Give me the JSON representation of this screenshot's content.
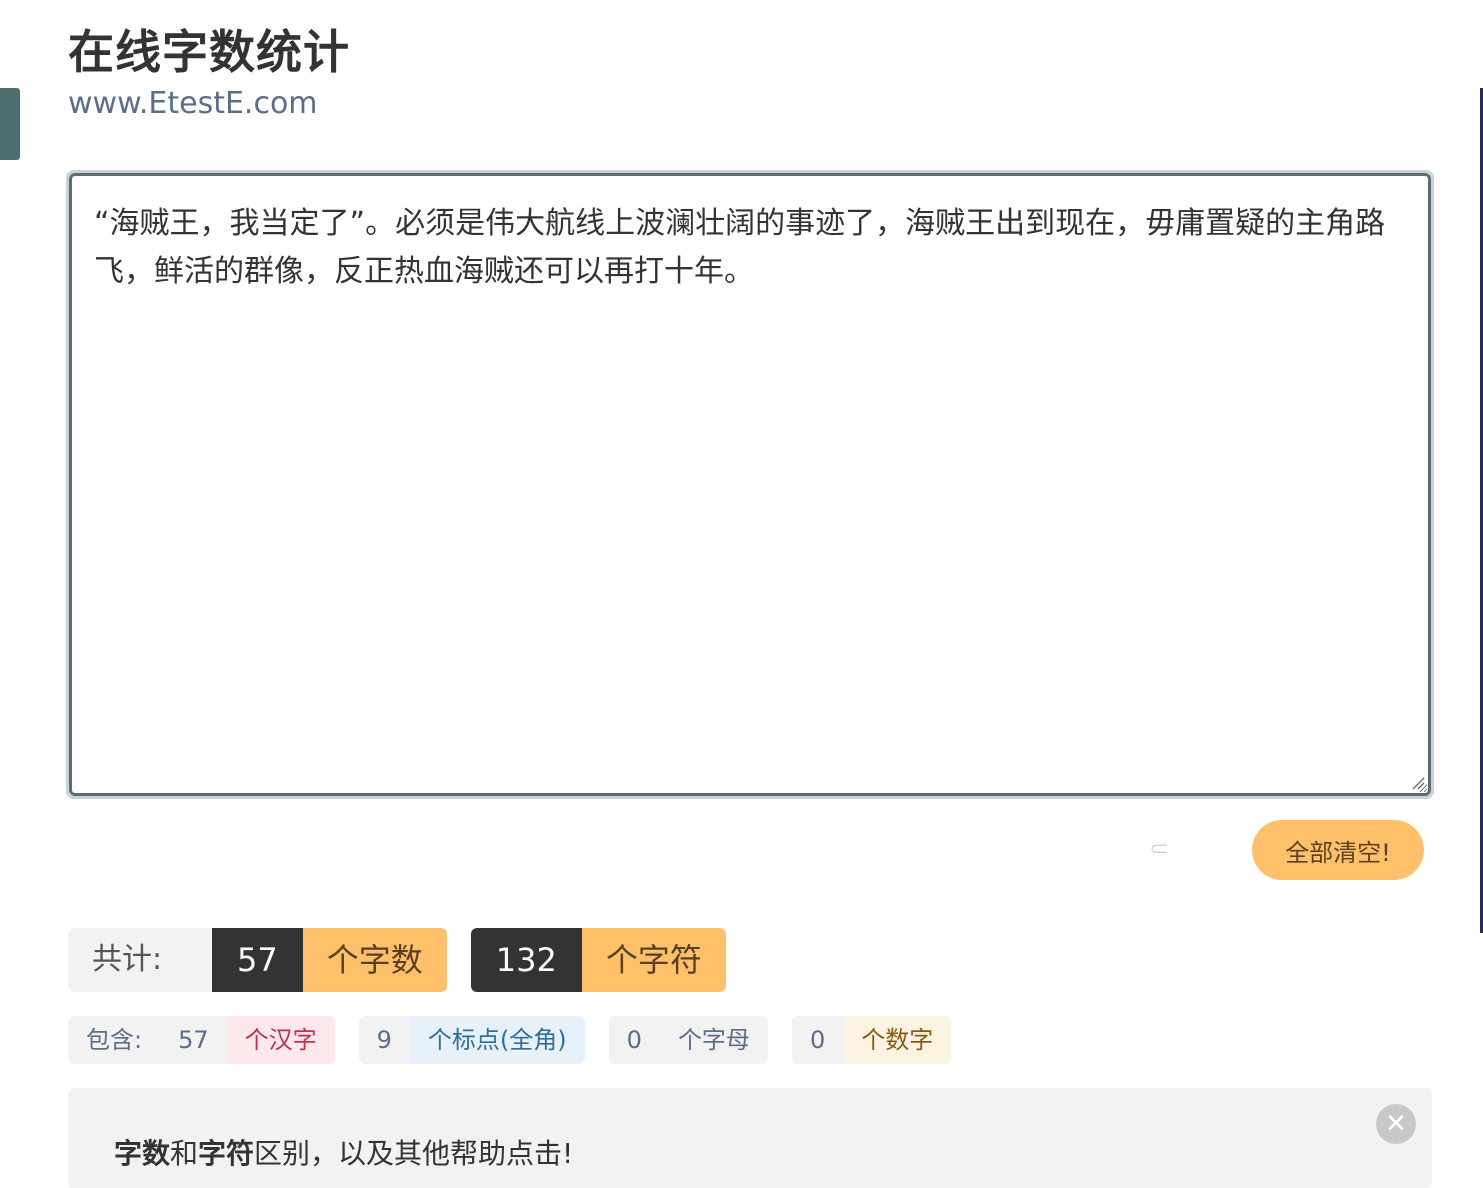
{
  "header": {
    "title": "在线字数统计",
    "subtitle": "www.EtestE.com"
  },
  "editor": {
    "text": "“海贼王，我当定了”。必须是伟大航线上波澜壮阔的事迹了，海贼王出到现在，毋庸置疑的主角路飞，鲜活的群像，反正热血海贼还可以再打十年。"
  },
  "actions": {
    "clear_label": "全部清空!",
    "spinner_icon": "loading-spinner-icon"
  },
  "totals": {
    "label": "共计:",
    "word_count": "57",
    "word_unit": "个字数",
    "char_count": "132",
    "char_unit": "个字符"
  },
  "breakdown": {
    "label": "包含:",
    "items": [
      {
        "count": "57",
        "unit": "个汉字"
      },
      {
        "count": "9",
        "unit": "个标点(全角)"
      },
      {
        "count": "0",
        "unit": "个字母"
      },
      {
        "count": "0",
        "unit": "个数字"
      }
    ]
  },
  "help": {
    "part1": "字数",
    "part2": "和",
    "part3": "字符",
    "part4": "区别，以及其他帮助点击!",
    "close_icon": "close-icon"
  },
  "colors": {
    "accent": "#ffc06a",
    "dark": "#333333",
    "editor_border": "#5a6e72",
    "subtitle": "#5a6e8c"
  }
}
